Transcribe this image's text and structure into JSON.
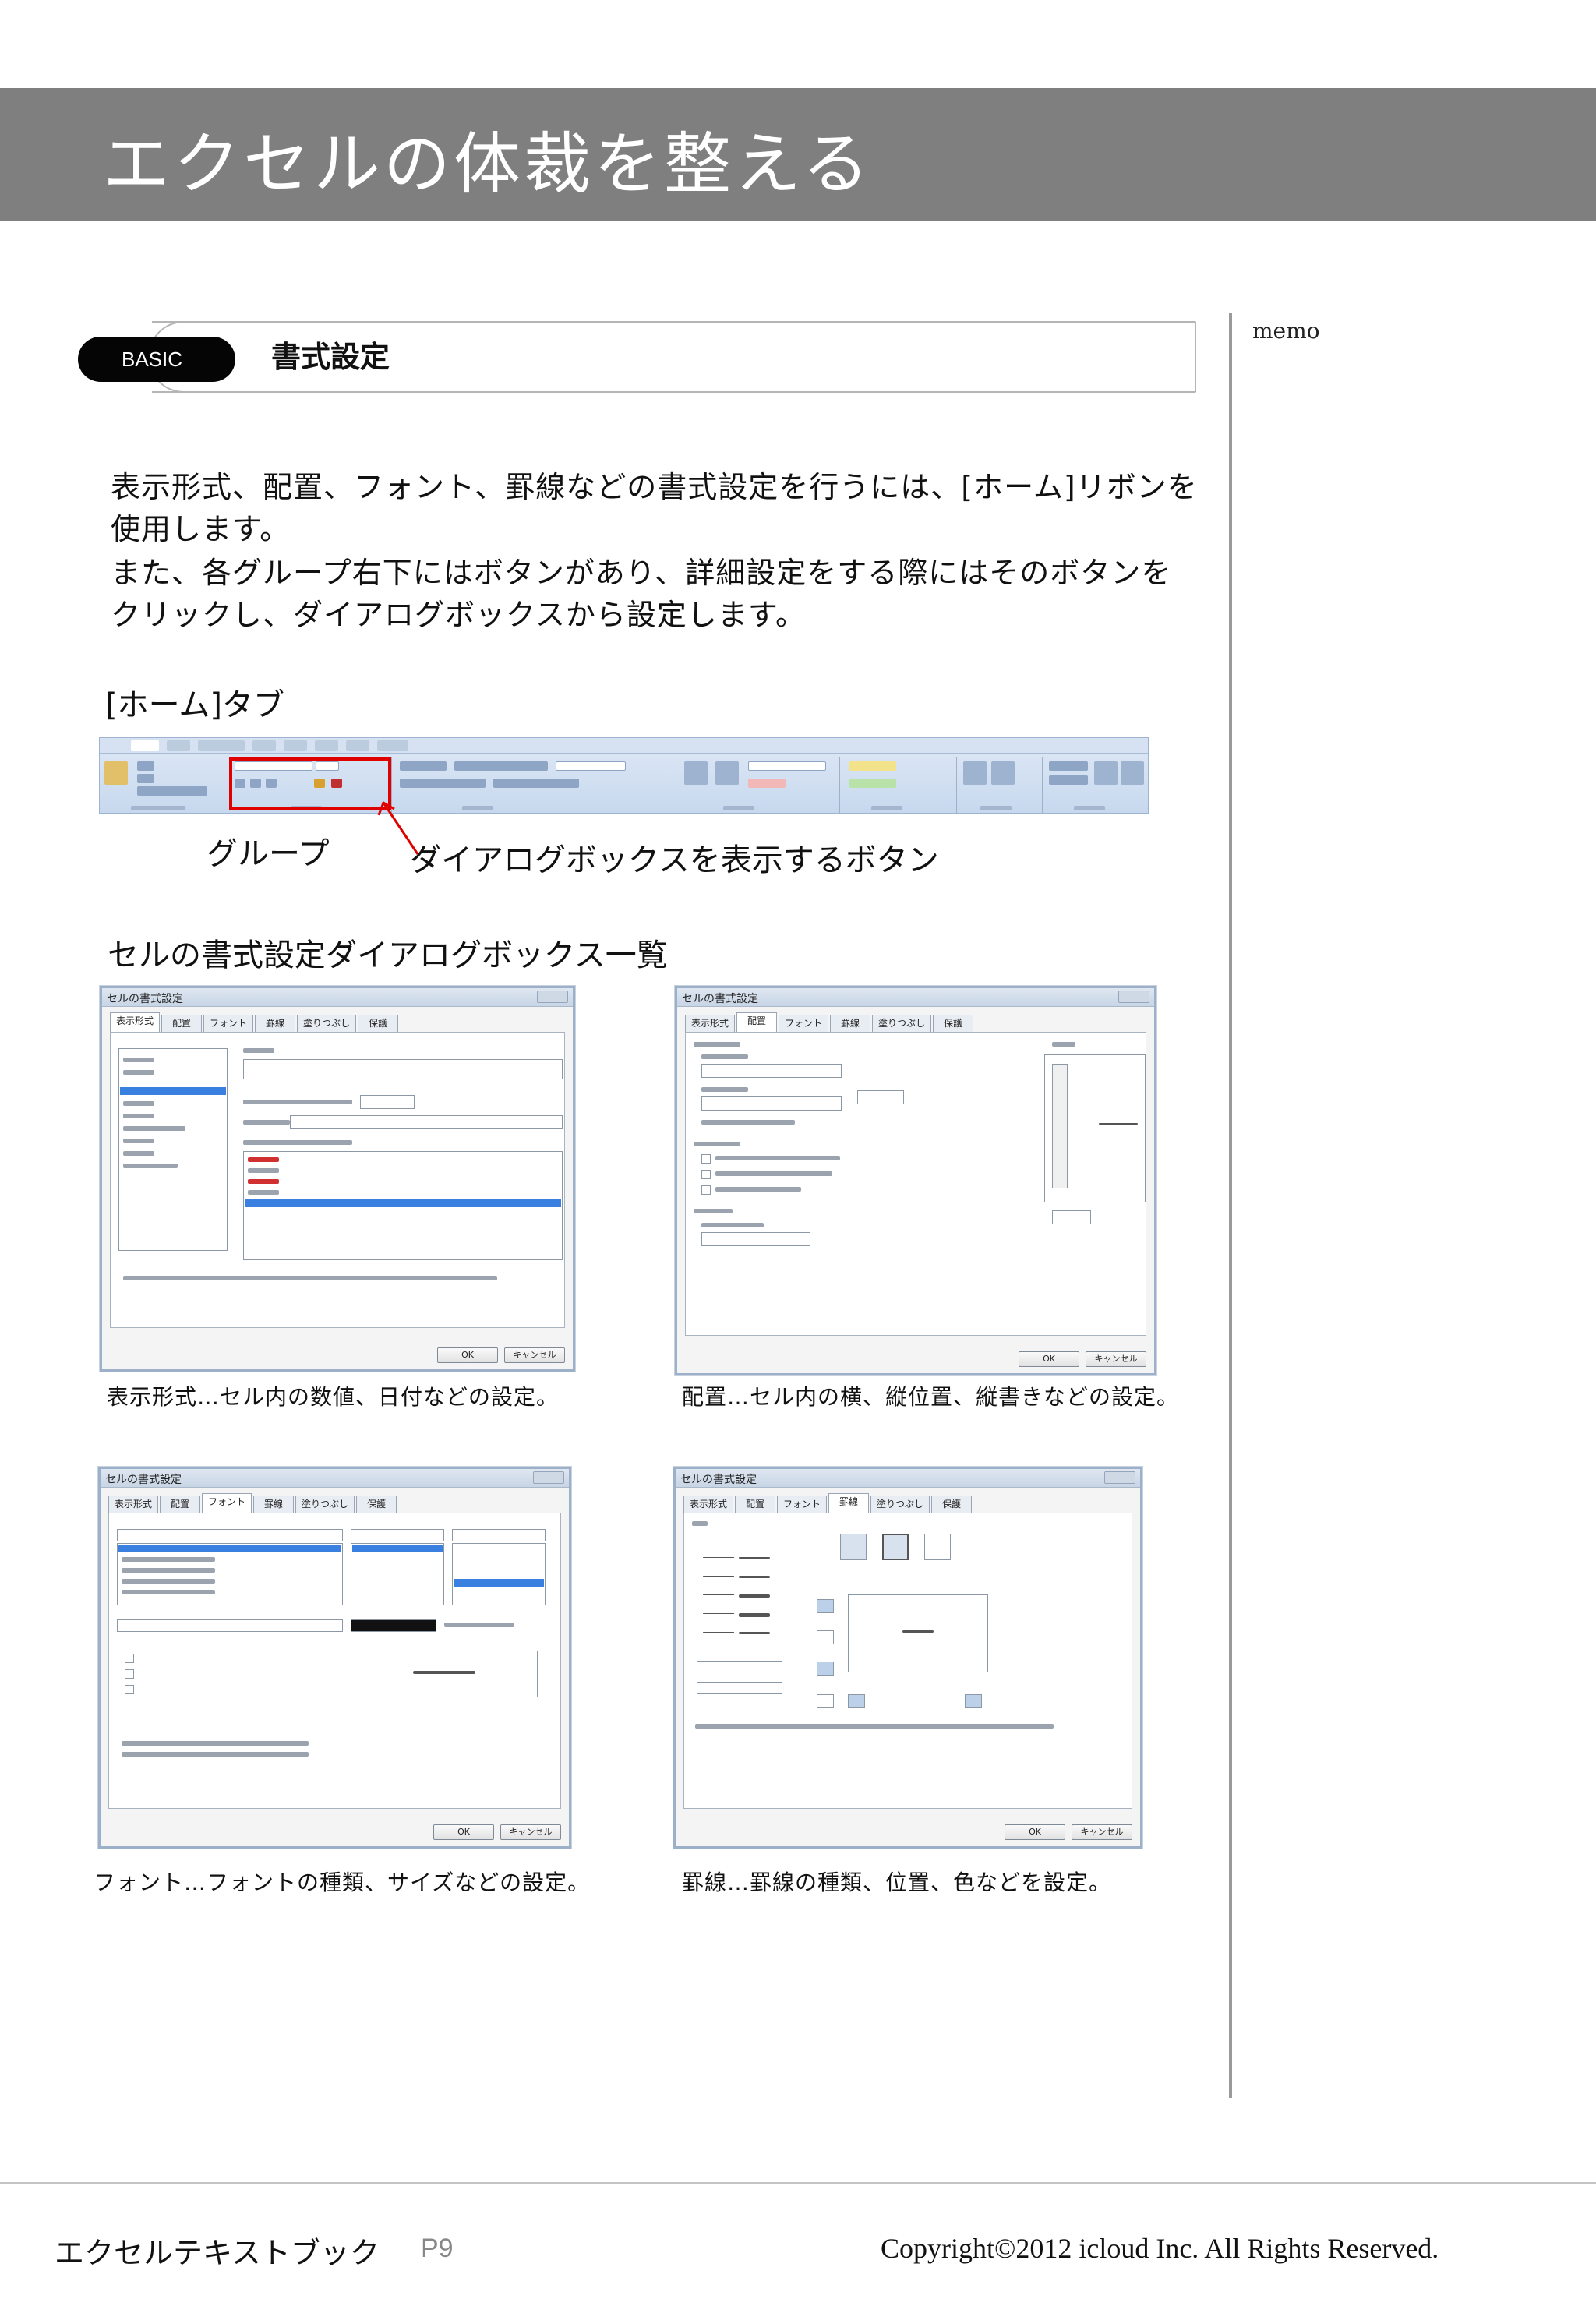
{
  "page": {
    "title": "エクセルの体裁を整える",
    "memo_label": "memo"
  },
  "section": {
    "badge": "BASIC",
    "title": "書式設定"
  },
  "body": {
    "paragraph1": "表示形式、配置、フォント、罫線などの書式設定を行うには、[ホーム]リボンを使用します。",
    "paragraph2": "また、各グループ右下にはボタンがあり、詳細設定をする際にはそのボタンをクリックし、ダイアログボックスから設定します。",
    "home_tab_heading": "[ホーム]タブ",
    "group_label": "グループ",
    "dialog_button_label": "ダイアログボックスを表示するボタン",
    "dialog_list_heading": "セルの書式設定ダイアログボックス一覧"
  },
  "dialogs": {
    "window_title": "セルの書式設定",
    "tabs": [
      "表示形式",
      "配置",
      "フォント",
      "罫線",
      "塗りつぶし",
      "保護"
    ],
    "ok_label": "OK",
    "cancel_label": "キャンセル",
    "number": {
      "caption": "表示形式…セル内の数値、日付などの設定。"
    },
    "alignment": {
      "caption": "配置…セル内の横、縦位置、縦書きなどの設定。"
    },
    "font": {
      "caption": "フォント…フォントの種類、サイズなどの設定。"
    },
    "border": {
      "caption": "罫線…罫線の種類、位置、色などを設定。"
    }
  },
  "footer": {
    "book_title": "エクセルテキストブック",
    "page_number": "P9",
    "copyright": "Copyright©2012 icloud Inc. All Rights Reserved."
  },
  "colors": {
    "header_band": "#7f7f7f",
    "highlight": "#e00000",
    "badge": "#050505"
  }
}
